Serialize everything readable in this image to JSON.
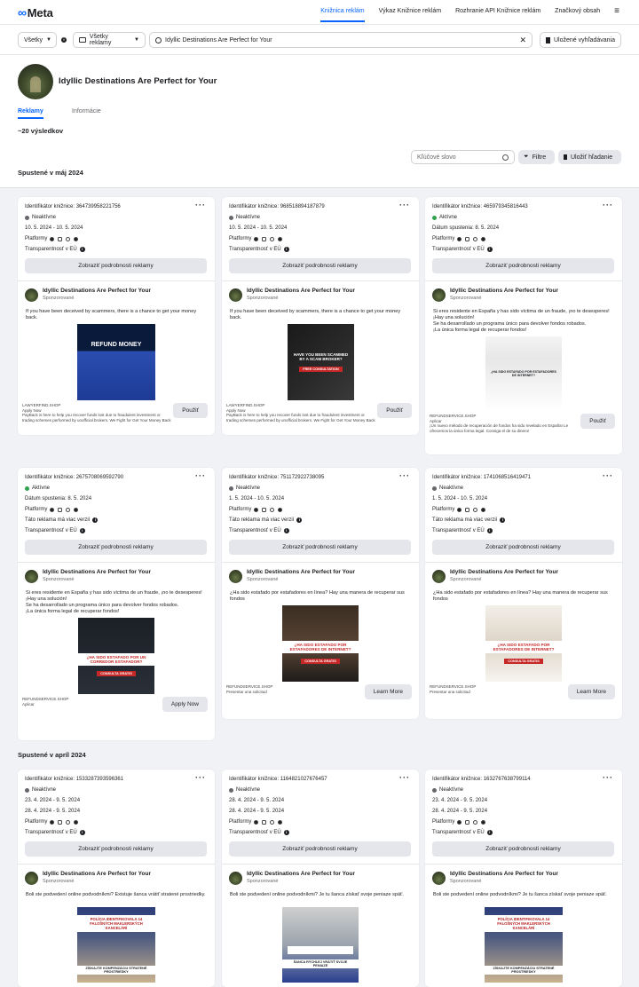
{
  "top": {
    "logo": "Meta",
    "nav": [
      "Knižnica reklám",
      "Výkaz Knižnice reklám",
      "Rozhranie API Knižnice reklám",
      "Značkový obsah"
    ],
    "accent": "#0866ff"
  },
  "filters": {
    "country": "Všetky",
    "ad_type": "Všetky reklamy",
    "search_value": "Idyllic Destinations Are Perfect for Your",
    "saved": "Uložené vyhľadávania"
  },
  "page": {
    "title": "Idyllic Destinations Are Perfect for Your",
    "tabs": [
      "Reklamy",
      "Informácie"
    ],
    "results": "~20 výsledkov",
    "keyword_placeholder": "Kľúčové slovo",
    "filters_btn": "Filtre",
    "save_btn": "Uložiť hľadanie"
  },
  "sections": [
    "Spustené v máj 2024",
    "Spustené v apríl 2024"
  ],
  "common": {
    "detail_btn": "Zobraziť podrobnosti reklamy",
    "platforms_label": "Platformy",
    "transparency": "Transparentnosť v EÚ",
    "advertiser": "Idyllic Destinations Are Perfect for Your",
    "sponsored": "Sponzorované",
    "multi": "Táto reklama má viac verzií"
  },
  "cards": [
    {
      "id": "Identifikátor knižnice: 364739958221756",
      "status": "Neaktívne",
      "status_color": "#65676b",
      "date": "10. 5. 2024 - 10. 5. 2024",
      "body": "If you have been deceived by scammers, there is a chance to get your money back.",
      "creative": "REFUND MONEY",
      "foot": "LAWYERFIND.SHOP\nApply Now\nPayBack is here to help you recover funds lost due to fraudulent investment or trading schemes performed by unofficial brokers. We Fight for Get Your Money Back",
      "cta": "Použiť"
    },
    {
      "id": "Identifikátor knižnice: 968518894187879",
      "status": "Neaktívne",
      "status_color": "#65676b",
      "date": "10. 5. 2024 - 10. 5. 2024",
      "body": "If you have been deceived by scammers, there is a chance to get your money back.",
      "creative": "HAVE YOU BEEN SCAMMED BY A SCAM BROKER?",
      "creative2": "FREE CONSULTATION",
      "foot": "LAWYERFIND.SHOP\nApply Now\nPayBack is here to help you recover funds lost due to fraudulent investment or trading schemes performed by unofficial brokers. We Fight for Get Your Money Back",
      "cta": "Použiť"
    },
    {
      "id": "Identifikátor knižnice: 465979345816443",
      "status": "Aktívne",
      "status_color": "#31a24c",
      "date": "Dátum spustenia: 8. 5. 2024",
      "body": "Si eres residente en España y has sido víctima de un fraude, ¡no te desesperes!\n¡Hay una solución!\nSe ha desarrollado un programa único para devolver fondos robados.\n¡La única forma legal de recuperar fondos!",
      "creative": "¿HA SIDO ESTAFADO POR ESTAFADORES DE INTERNET?",
      "foot": "REFUNDSERVICE.SHOP\nAplicar\n¡Un nuevo método de recuperación de fondos ha sido revelado en España! Le ofrecemos la única forma legal. Consiga el de su dinero!",
      "cta": "Použiť"
    },
    {
      "id": "Identifikátor knižnice: 2675708069592790",
      "status": "Aktívne",
      "status_color": "#31a24c",
      "date": "Dátum spustenia: 8. 5. 2024",
      "body": "Si eres residente en España y has sido víctima de un fraude, ¡no te desesperes!\n¡Hay una solución!\nSe ha desarrollado un programa único para devolver fondos robados.\n¡La única forma legal de recuperar fondos!",
      "creative": "¿HA SIDO ESTAFADO POR UN CORREDOR ESTAFADOR?",
      "creative2": "CONSULTA GRATIS",
      "foot": "REFUNDSERVICE.SHOP\nAplicar",
      "cta": "Apply Now"
    },
    {
      "id": "Identifikátor knižnice: 751172922738095",
      "status": "Neaktívne",
      "status_color": "#65676b",
      "date": "1. 5. 2024 - 10. 5. 2024",
      "body": "¿Ha sido estafado por estafadores en línea? Hay una manera de recuperar sus fondos",
      "creative": "¿HA SIDO ESTAFADO POR ESTAFADORES DE INTERNET?",
      "creative2": "CONSULTA GRATIS",
      "foot": "REFUNDSERVICE.SHOP\nPresentar una solicitud",
      "cta": "Learn More"
    },
    {
      "id": "Identifikátor knižnice: 1741068516419471",
      "status": "Neaktívne",
      "status_color": "#65676b",
      "date": "1. 5. 2024 - 10. 5. 2024",
      "body": "¿Ha sido estafado por estafadores en línea? Hay una manera de recuperar sus fondos",
      "creative": "¿HA SIDO ESTAFADO POR ESTAFADORES DE INTERNET?",
      "creative2": "CONSULTA GRATIS",
      "foot": "REFUNDSERVICE.SHOP\nPresentar una solicitud",
      "cta": "Learn More"
    },
    {
      "id": "Identifikátor knižnice: 1533287393596361",
      "status": "Neaktívne",
      "status_color": "#65676b",
      "date": "23. 4. 2024 - 9. 5. 2024",
      "date2": "28. 4. 2024 - 9. 5. 2024",
      "body": "Boli ste podvedení online podvodníkmi? Existuje šanca vrátiť stratené prostriedky.",
      "creative": "POLÍCIA IDENTIFIKOVALA 14 FALOŠNÝCH MAKLERSKÝCH KANCELÁRÍ",
      "creative2": "ZÍSKAJTE KOMPENZÁCIU STRATENÉ PROSTRIEDKY"
    },
    {
      "id": "Identifikátor knižnice: 1164821027676457",
      "status": "Neaktívne",
      "status_color": "#65676b",
      "date": "28. 4. 2024 - 9. 5. 2024",
      "date2": "28. 4. 2024 - 9. 5. 2024",
      "body": "Boli ste podvedení online podvodníkmi? Je tu šanca získať svoje peniaze späť.",
      "creative": "ZÁCHRANA PODVODNÉ MAKLÉRI",
      "creative2": "ŠANCA RÝCHLEJ VRÁTIŤ SVOJE PENIAZE"
    },
    {
      "id": "Identifikátor knižnice: 1632767638799114",
      "status": "Neaktívne",
      "status_color": "#65676b",
      "date": "23. 4. 2024 - 9. 5. 2024",
      "date2": "28. 4. 2024 - 9. 5. 2024",
      "body": "Boli ste podvedení online podvodníkmi? Je tu šanca získať svoje peniaze späť.",
      "creative": "POLÍCIA IDENTIFIKOVALA 14 FALOŠNÝCH MAKLERSKÝCH KANCELÁRÍ",
      "creative2": "ZÍSKAJTE KOMPENZÁCIU STRATENÉ PROSTRIEDKY"
    }
  ]
}
